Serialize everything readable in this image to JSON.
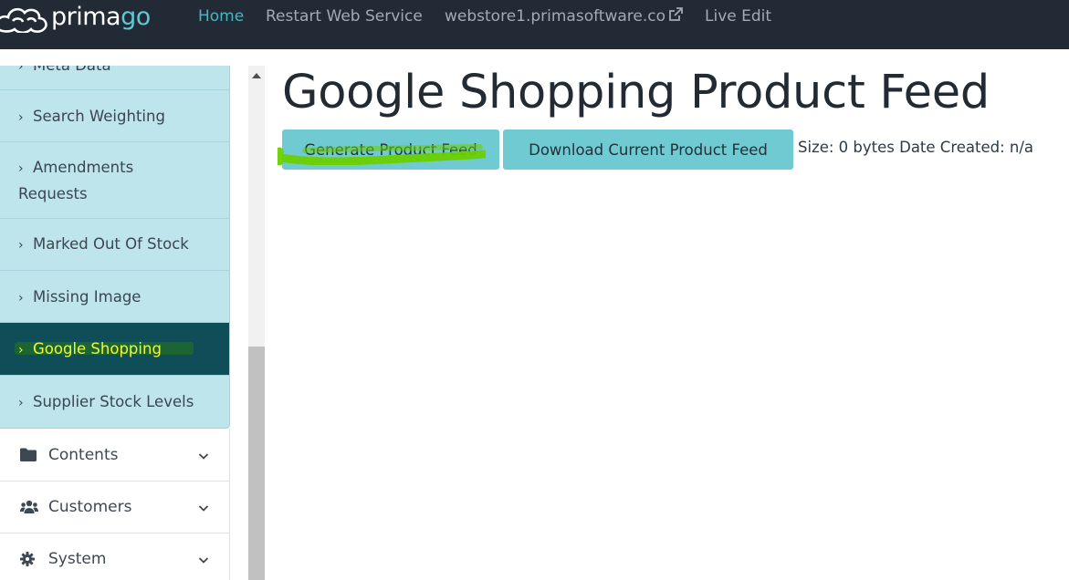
{
  "brand": {
    "name_main": "prima",
    "name_accent": "go",
    "logo_icon": "cloud-logo-icon",
    "accent_color": "#5cc9d3"
  },
  "navbar": {
    "background": "#222a35",
    "links": [
      {
        "label": "Home",
        "active": true
      },
      {
        "label": "Restart Web Service",
        "active": false
      },
      {
        "label": "webstore1.primasoftware.co",
        "active": false,
        "icon": "external-link-icon"
      },
      {
        "label": "Live Edit",
        "active": false
      }
    ]
  },
  "sidebar": {
    "sub_items": [
      {
        "label": "Meta Data",
        "active": false
      },
      {
        "label": "Search Weighting",
        "active": false
      },
      {
        "label": "Amendments Requests",
        "active": false
      },
      {
        "label": "Marked Out Of Stock",
        "active": false
      },
      {
        "label": "Missing Image",
        "active": false
      },
      {
        "label": "Google Shopping",
        "active": true
      },
      {
        "label": "Supplier Stock Levels",
        "active": false
      }
    ],
    "main_items": [
      {
        "label": "Contents",
        "icon": "folder-icon"
      },
      {
        "label": "Customers",
        "icon": "users-icon"
      },
      {
        "label": "System",
        "icon": "gear-icon"
      }
    ],
    "sub_bg": "#bfe5ec",
    "active_bg": "#0f4d58",
    "active_text": "#f4f43a"
  },
  "main": {
    "title": "Google Shopping Product Feed",
    "generate_button": "Generate Product Feed",
    "download_button": "Download Current Product Feed",
    "size_info": "Size: 0 bytes Date Created: n/a",
    "button_color": "#6fcbd1",
    "highlight_color": "#6ccf00"
  }
}
